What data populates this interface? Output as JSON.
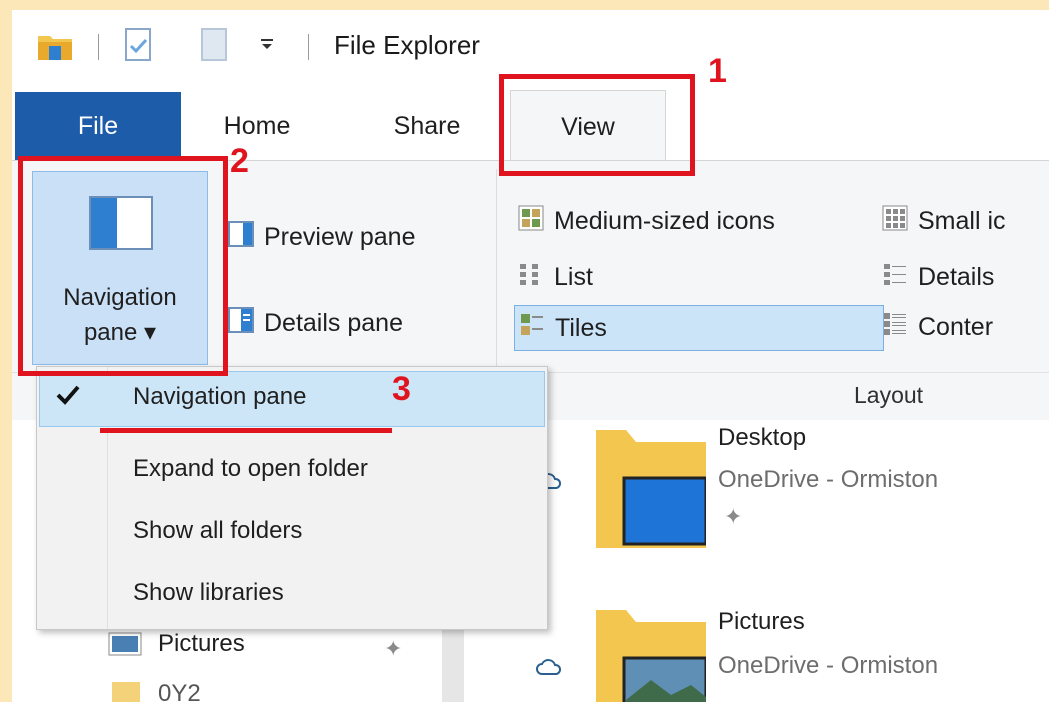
{
  "window": {
    "title": "File Explorer"
  },
  "tabs": {
    "file": "File",
    "home": "Home",
    "share": "Share",
    "view": "View"
  },
  "ribbon": {
    "navigation_pane_line1": "Navigation",
    "navigation_pane_line2": "pane ▾",
    "preview_pane": "Preview pane",
    "details_pane": "Details pane",
    "layout": {
      "medium_icons": "Medium-sized icons",
      "small_icons": "Small ic",
      "list": "List",
      "details": "Details",
      "tiles": "Tiles",
      "content": "Conter",
      "group_label": "Layout"
    }
  },
  "nav_dropdown": {
    "checked_item": "Navigation pane",
    "items": [
      "Expand to open folder",
      "Show all folders",
      "Show libraries"
    ]
  },
  "nav_tree": {
    "pictures": "Pictures",
    "partial": "0Y2"
  },
  "files": [
    {
      "name": "Desktop",
      "location": "OneDrive - Ormiston"
    },
    {
      "name": "Pictures",
      "location": "OneDrive - Ormiston"
    }
  ],
  "annotations": {
    "step1": "1",
    "step2": "2",
    "step3": "3"
  },
  "colors": {
    "accent": "#1d5ca8",
    "annotation": "#e0141e",
    "selection": "#cce4f7"
  }
}
